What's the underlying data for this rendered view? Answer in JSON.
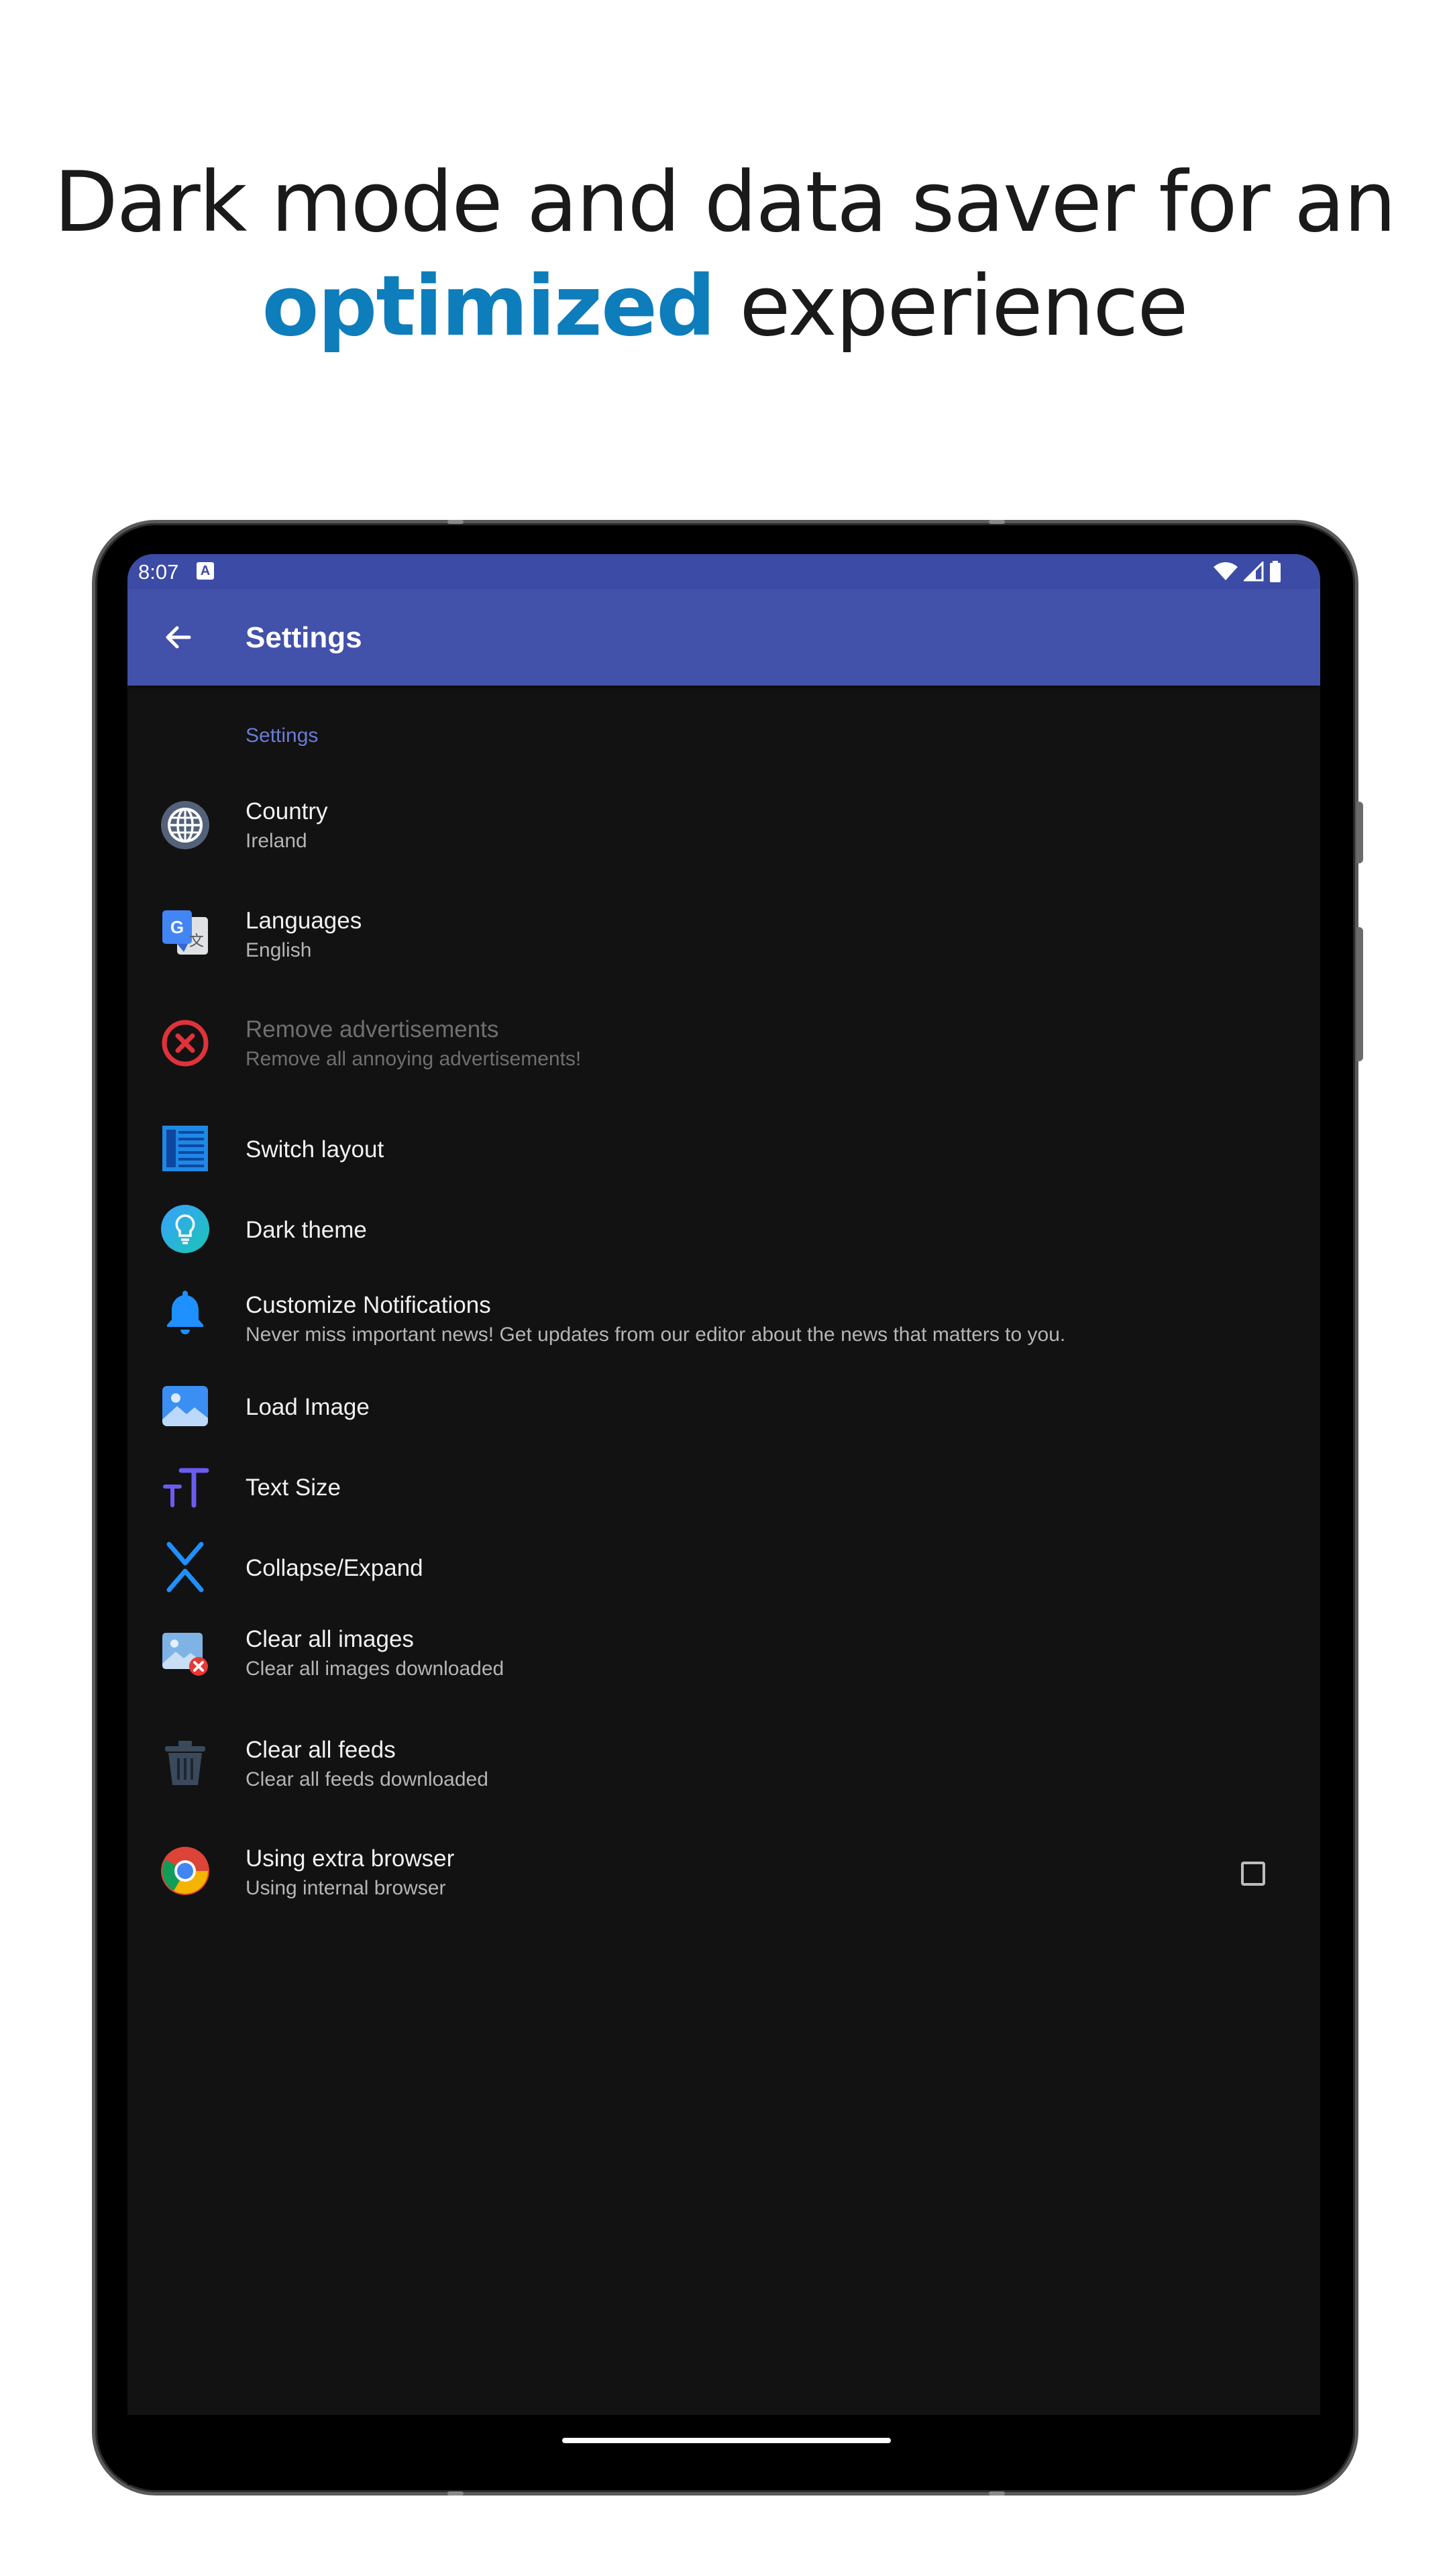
{
  "headline": {
    "line1": "Dark mode and data saver for an",
    "accent": "optimized",
    "rest": " experience"
  },
  "statusbar": {
    "time": "8:07",
    "notification_badge": "A"
  },
  "toolbar": {
    "title": "Settings"
  },
  "section_label": "Settings",
  "items": [
    {
      "title": "Country",
      "subtitle": "Ireland",
      "icon": "globe-icon"
    },
    {
      "title": "Languages",
      "subtitle": "English",
      "icon": "google-translate-icon"
    },
    {
      "title": "Remove advertisements",
      "subtitle": "Remove all annoying advertisements!",
      "icon": "close-circle-icon",
      "disabled": true
    },
    {
      "title": "Switch layout",
      "subtitle": "",
      "icon": "list-layout-icon"
    },
    {
      "title": "Dark theme",
      "subtitle": "",
      "icon": "lightbulb-icon"
    },
    {
      "title": "Customize Notifications",
      "subtitle": "Never miss important news! Get updates from our editor about the news that matters to you.",
      "icon": "bell-icon"
    },
    {
      "title": "Load Image",
      "subtitle": "",
      "icon": "image-icon"
    },
    {
      "title": "Text Size",
      "subtitle": "",
      "icon": "text-size-icon"
    },
    {
      "title": "Collapse/Expand",
      "subtitle": "",
      "icon": "collapse-expand-icon"
    },
    {
      "title": "Clear all images",
      "subtitle": "Clear all images downloaded",
      "icon": "clear-images-icon"
    },
    {
      "title": "Clear all feeds",
      "subtitle": "Clear all feeds downloaded",
      "icon": "trash-icon"
    },
    {
      "title": "Using extra browser",
      "subtitle": "Using internal browser",
      "icon": "chrome-icon",
      "checked": false
    }
  ],
  "colors": {
    "accent": "#0e7dbb",
    "toolbar": "#4251aa",
    "statusbar": "#3c4ba6",
    "background": "#121212"
  }
}
